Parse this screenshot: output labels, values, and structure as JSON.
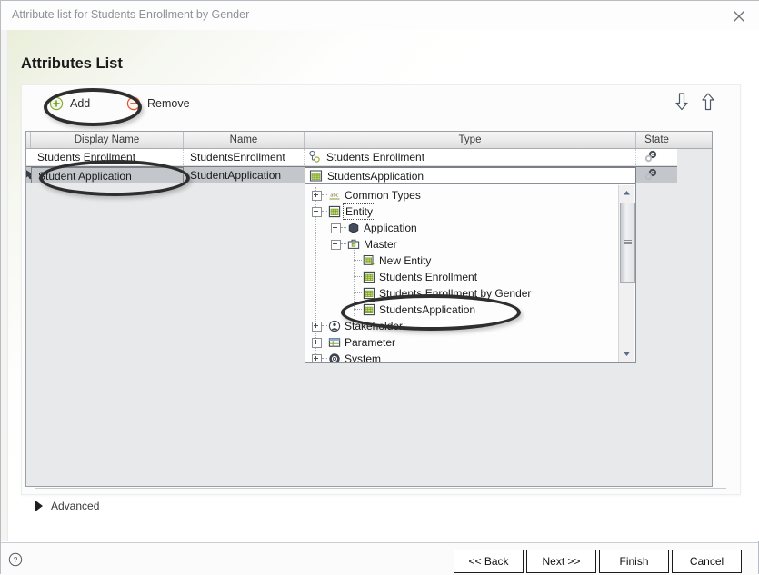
{
  "window": {
    "title": "Attribute list for Students Enrollment by Gender",
    "close_icon": "close-icon"
  },
  "heading": "Attributes List",
  "toolbar": {
    "add_label": "Add",
    "add_icon": "plus-circle-icon",
    "remove_label": "Remove",
    "remove_icon": "minus-circle-icon",
    "move_down_icon": "arrow-down-icon",
    "move_up_icon": "arrow-up-icon"
  },
  "grid": {
    "columns": [
      "Display Name",
      "Name",
      "Type",
      "State"
    ],
    "rows": [
      {
        "display_name": "Students Enrollment",
        "name": "StudentsEnrollment",
        "type": "Students Enrollment",
        "type_icon": "relationship-icon",
        "state_icon": "gear-icon",
        "selected": false
      },
      {
        "display_name": "Student Application",
        "name": "StudentApplication",
        "type": "StudentsApplication",
        "type_icon": "entity-icon",
        "state_icon": "gear-icon",
        "selected": true
      }
    ]
  },
  "tree": {
    "nodes": [
      {
        "label": "Common Types",
        "depth": 0,
        "expander": "plus",
        "icon": "abc-icon",
        "focused": false,
        "annotated": false
      },
      {
        "label": "Entity",
        "depth": 0,
        "expander": "minus",
        "icon": "entity-icon",
        "focused": true,
        "annotated": false
      },
      {
        "label": "Application",
        "depth": 1,
        "expander": "plus",
        "icon": "application-icon",
        "focused": false,
        "annotated": false
      },
      {
        "label": "Master",
        "depth": 1,
        "expander": "minus",
        "icon": "folder-icon",
        "focused": false,
        "annotated": false
      },
      {
        "label": "New Entity",
        "depth": 2,
        "expander": "none",
        "icon": "new-entity-icon",
        "focused": false,
        "annotated": false
      },
      {
        "label": "Students Enrollment",
        "depth": 2,
        "expander": "none",
        "icon": "entity-icon",
        "focused": false,
        "annotated": false
      },
      {
        "label": "Students Enrollment by Gender",
        "depth": 2,
        "expander": "none",
        "icon": "entity-icon",
        "focused": false,
        "annotated": false
      },
      {
        "label": "StudentsApplication",
        "depth": 2,
        "expander": "none",
        "icon": "entity-icon",
        "focused": false,
        "annotated": true
      },
      {
        "label": "Stakeholder",
        "depth": 0,
        "expander": "plus",
        "icon": "stakeholder-icon",
        "focused": false,
        "annotated": false
      },
      {
        "label": "Parameter",
        "depth": 0,
        "expander": "plus",
        "icon": "parameter-icon",
        "focused": false,
        "annotated": false
      },
      {
        "label": "System",
        "depth": 0,
        "expander": "plus",
        "icon": "system-gear-icon",
        "focused": false,
        "annotated": false
      }
    ],
    "scrollbar": {
      "up_icon": "scroll-up-icon",
      "down_icon": "scroll-down-icon"
    }
  },
  "advanced": {
    "label": "Advanced",
    "icon": "triangle-right-icon"
  },
  "footer": {
    "help_icon": "help-circle-icon",
    "back_label": "<< Back",
    "next_label": "Next >>",
    "finish_label": "Finish",
    "cancel_label": "Cancel"
  },
  "colors": {
    "accent_orange": "#eea22f",
    "icon_green": "#7a9a23",
    "selection_gray": "#c3c7cc",
    "annotation": "#2e2e2e"
  }
}
